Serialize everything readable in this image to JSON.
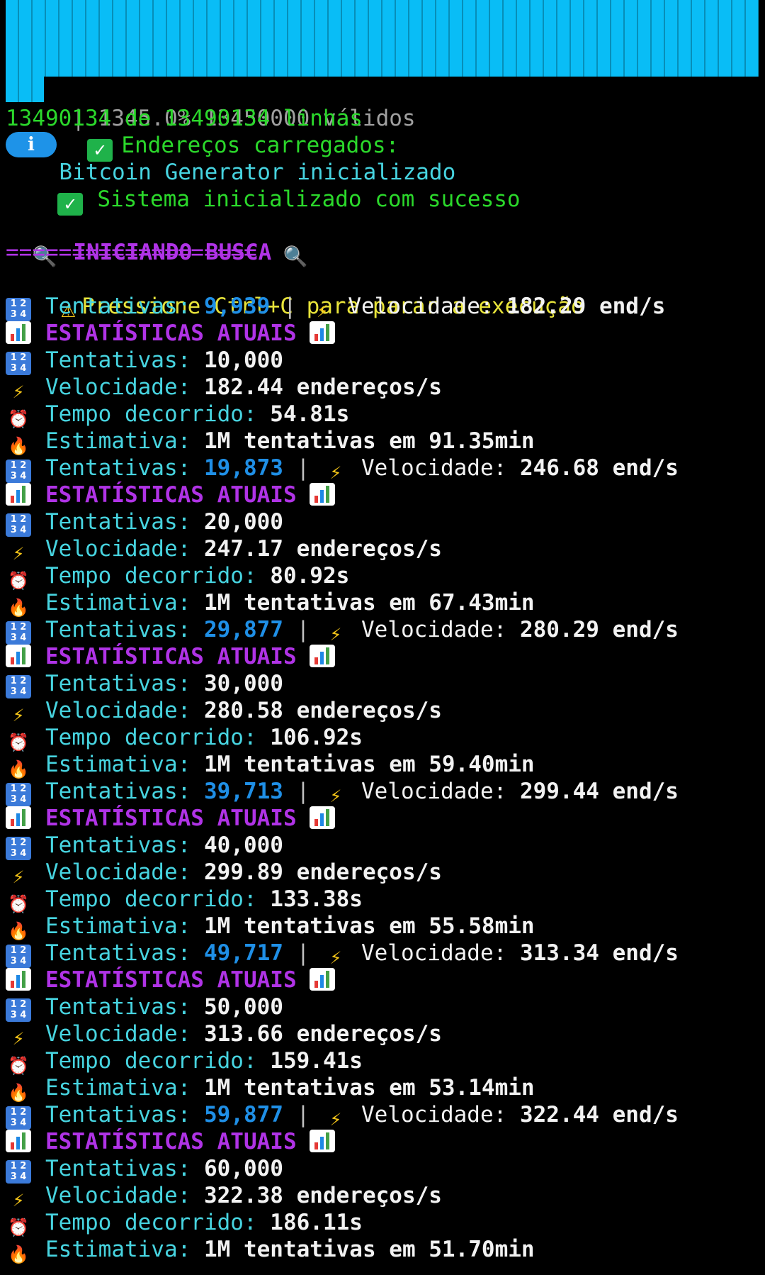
{
  "colors": {
    "progress": "#09bdf6",
    "green": "#2bd82b",
    "cyan": "#47d4e0",
    "blue": "#1f8fe6",
    "purple": "#b033e6",
    "yellow": "#e8e43a"
  },
  "header": {
    "progress_text": "| 1345.0% 13450000 válidos",
    "loaded_label": "Endereços carregados:",
    "loaded_count": "13490134 de 13490134 linhas",
    "generator_rest": "Bitcoin Generator inicializado",
    "system_ok": "Sistema inicializado com sucesso"
  },
  "search": {
    "title": "INICIANDO BUSCA",
    "divider": "===================",
    "warning": "Pressione Ctrl+C para parar a execução"
  },
  "labels": {
    "attempts": "Tentativas:",
    "speed": "Velocidade:",
    "stats": "ESTATÍSTICAS ATUAIS",
    "elapsed": "Tempo decorrido:",
    "estimate": "Estimativa:",
    "pipe": "|"
  },
  "blocks": [
    {
      "progress_attempts": "9,939",
      "progress_speed": "182.29 end/s",
      "attempts": "10,000",
      "speed": "182.44 endereços/s",
      "elapsed": "54.81s",
      "estimate": "1M tentativas em 91.35min"
    },
    {
      "progress_attempts": "19,873",
      "progress_speed": "246.68 end/s",
      "attempts": "20,000",
      "speed": "247.17 endereços/s",
      "elapsed": "80.92s",
      "estimate": "1M tentativas em 67.43min"
    },
    {
      "progress_attempts": "29,877",
      "progress_speed": "280.29 end/s",
      "attempts": "30,000",
      "speed": "280.58 endereços/s",
      "elapsed": "106.92s",
      "estimate": "1M tentativas em 59.40min"
    },
    {
      "progress_attempts": "39,713",
      "progress_speed": "299.44 end/s",
      "attempts": "40,000",
      "speed": "299.89 endereços/s",
      "elapsed": "133.38s",
      "estimate": "1M tentativas em 55.58min"
    },
    {
      "progress_attempts": "49,717",
      "progress_speed": "313.34 end/s",
      "attempts": "50,000",
      "speed": "313.66 endereços/s",
      "elapsed": "159.41s",
      "estimate": "1M tentativas em 53.14min"
    },
    {
      "progress_attempts": "59,877",
      "progress_speed": "322.44 end/s",
      "attempts": "60,000",
      "speed": "322.38 endereços/s",
      "elapsed": "186.11s",
      "estimate": "1M tentativas em 51.70min"
    }
  ]
}
